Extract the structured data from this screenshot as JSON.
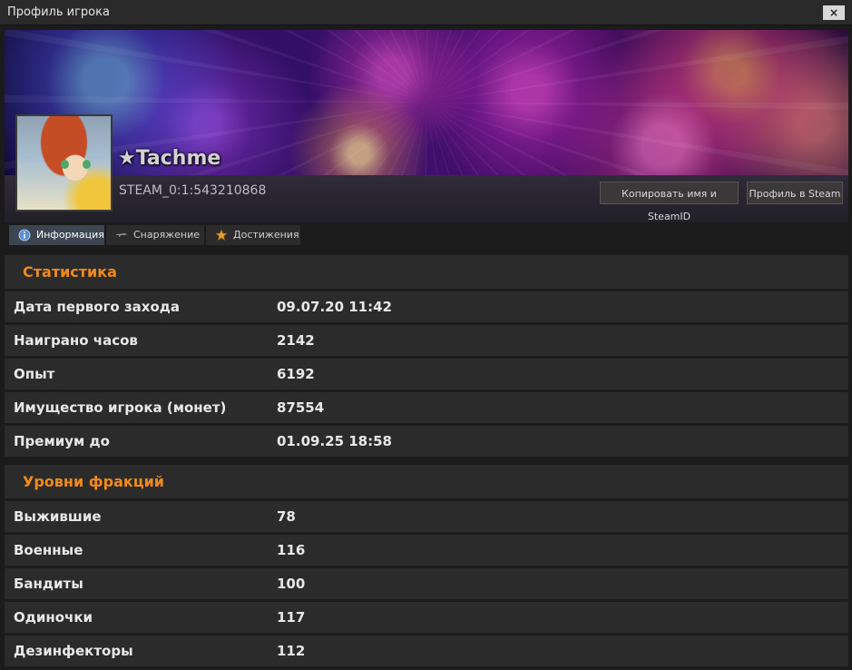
{
  "window": {
    "title": "Профиль игрока",
    "close_label": "×"
  },
  "profile": {
    "username": "★Tachme",
    "steam_id": "STEAM_0:1:543210868",
    "copy_button": "Копировать имя и SteamID",
    "steam_profile_button": "Профиль в Steam"
  },
  "tabs": [
    {
      "label": "Информация",
      "icon": "info-icon",
      "active": true
    },
    {
      "label": "Снаряжение",
      "icon": "rifle-icon",
      "active": false
    },
    {
      "label": "Достижения",
      "icon": "star-medal-icon",
      "active": false
    }
  ],
  "stats": {
    "title": "Статистика",
    "rows": [
      {
        "label": "Дата первого захода",
        "value": "09.07.20 11:42"
      },
      {
        "label": "Наиграно часов",
        "value": "2142"
      },
      {
        "label": "Опыт",
        "value": "6192"
      },
      {
        "label": "Имущество игрока (монет)",
        "value": "87554"
      },
      {
        "label": "Премиум до",
        "value": "01.09.25 18:58"
      }
    ]
  },
  "factions": {
    "title": "Уровни фракций",
    "rows": [
      {
        "label": "Выжившие",
        "value": "78"
      },
      {
        "label": "Военные",
        "value": "116"
      },
      {
        "label": "Бандиты",
        "value": "100"
      },
      {
        "label": "Одиночки",
        "value": "117"
      },
      {
        "label": "Дезинфекторы",
        "value": "112"
      }
    ]
  },
  "colors": {
    "section_title": "#f08a1c",
    "active_tab": "#3c4550",
    "panel": "#2b2b2b"
  }
}
